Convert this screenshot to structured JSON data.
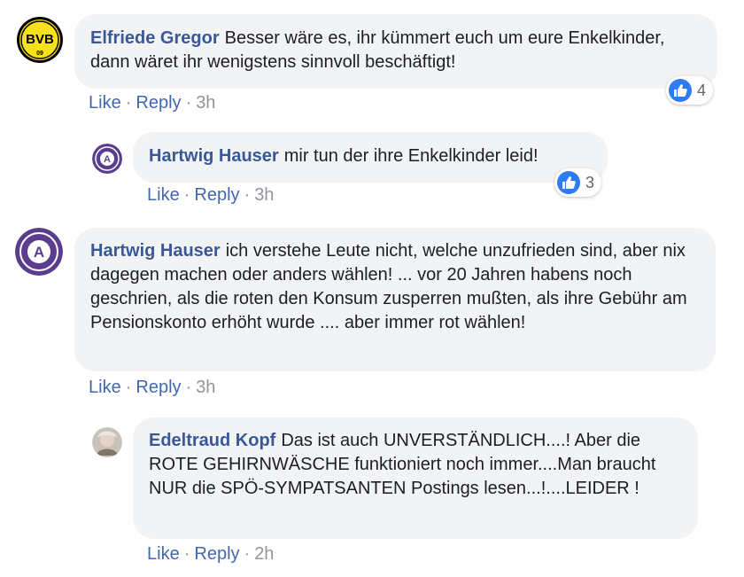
{
  "colors": {
    "author": "#385898",
    "link": "#4267b2",
    "meta": "#90949c",
    "bubble": "#f2f3f5",
    "like_blue": "#2e7bf6"
  },
  "actions": {
    "like": "Like",
    "reply": "Reply",
    "separator": "·"
  },
  "comments": [
    {
      "author": "Elfriede Gregor",
      "text": "Besser wäre es, ihr kümmert euch um eure Enkelkinder, dann wäret ihr wenigstens sinnvoll beschäftigt!",
      "time": "3h",
      "reaction_icon": "like-icon",
      "reaction_count": "4",
      "avatar_icon": "bvb-logo-icon"
    },
    {
      "author": "Hartwig Hauser",
      "text": "mir tun der ihre Enkelkinder leid!",
      "time": "3h",
      "reaction_icon": "like-icon",
      "reaction_count": "3",
      "avatar_icon": "austria-wien-logo-icon"
    },
    {
      "author": "Hartwig Hauser",
      "text": "ich verstehe Leute nicht, welche unzufrieden sind, aber nix dagegen machen oder anders wählen! ... vor 20 Jahren habens noch geschrien, als die roten den Konsum zusperren mußten, als ihre Gebühr am Pensionskonto erhöht wurde .... aber immer rot wählen!",
      "time": "3h",
      "avatar_icon": "austria-wien-logo-icon"
    },
    {
      "author": "Edeltraud Kopf",
      "text": "Das ist auch UNVERSTÄNDLICH....! Aber die ROTE GEHIRNWÄSCHE funktioniert noch immer....Man braucht NUR die SPÖ-SYMPATSANTEN Postings lesen...!....LEIDER !",
      "time": "2h",
      "avatar_icon": "user-photo-avatar"
    }
  ]
}
